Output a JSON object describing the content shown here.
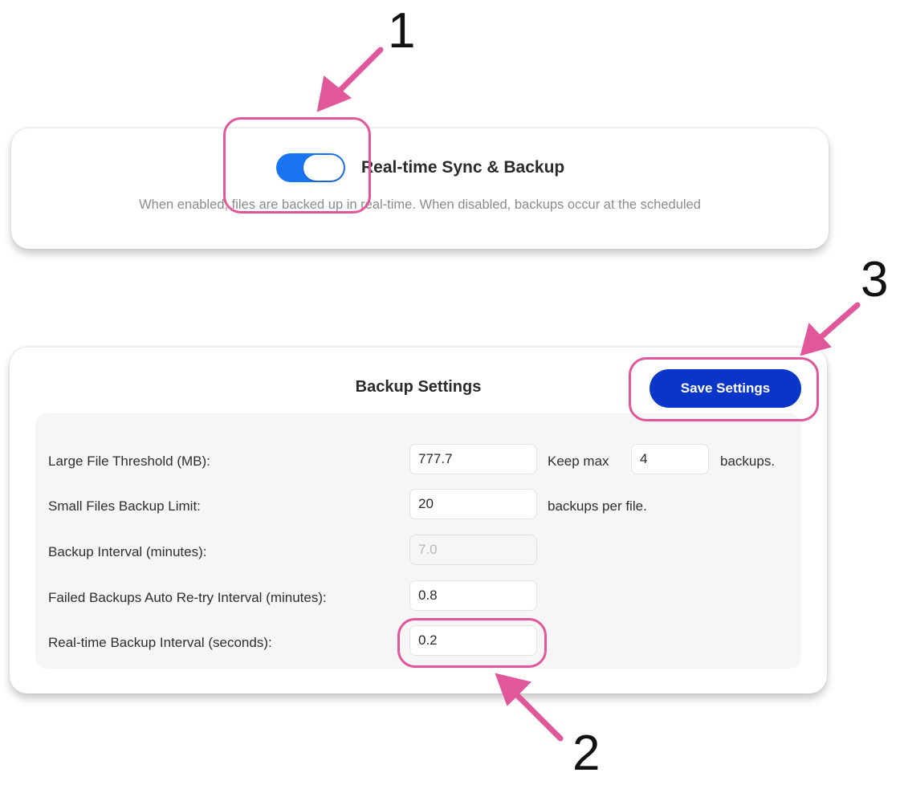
{
  "sync_card": {
    "title": "Real-time Sync & Backup",
    "description": "When enabled, files are backed up in real-time. When disabled, backups occur at the scheduled",
    "toggle_on": true
  },
  "settings_card": {
    "title": "Backup Settings",
    "save_label": "Save Settings",
    "fields": {
      "large_threshold": {
        "label": "Large File Threshold (MB):",
        "value": "777.7",
        "keep_prefix": "Keep max",
        "keep_value": "4",
        "keep_suffix": "backups."
      },
      "small_limit": {
        "label": "Small Files Backup Limit:",
        "value": "20",
        "suffix": "backups per file."
      },
      "interval": {
        "label": "Backup Interval (minutes):",
        "value": "7.0"
      },
      "retry": {
        "label": "Failed Backups Auto Re-try Interval (minutes):",
        "value": "0.8"
      },
      "realtime": {
        "label": "Real-time Backup Interval (seconds):",
        "value": "0.2"
      }
    }
  },
  "annotations": {
    "callout_1": "1",
    "callout_2": "2",
    "callout_3": "3",
    "color": "#e0579a"
  },
  "colors": {
    "toggle_on": "#1a73f0",
    "save_button": "#0a35c9"
  }
}
